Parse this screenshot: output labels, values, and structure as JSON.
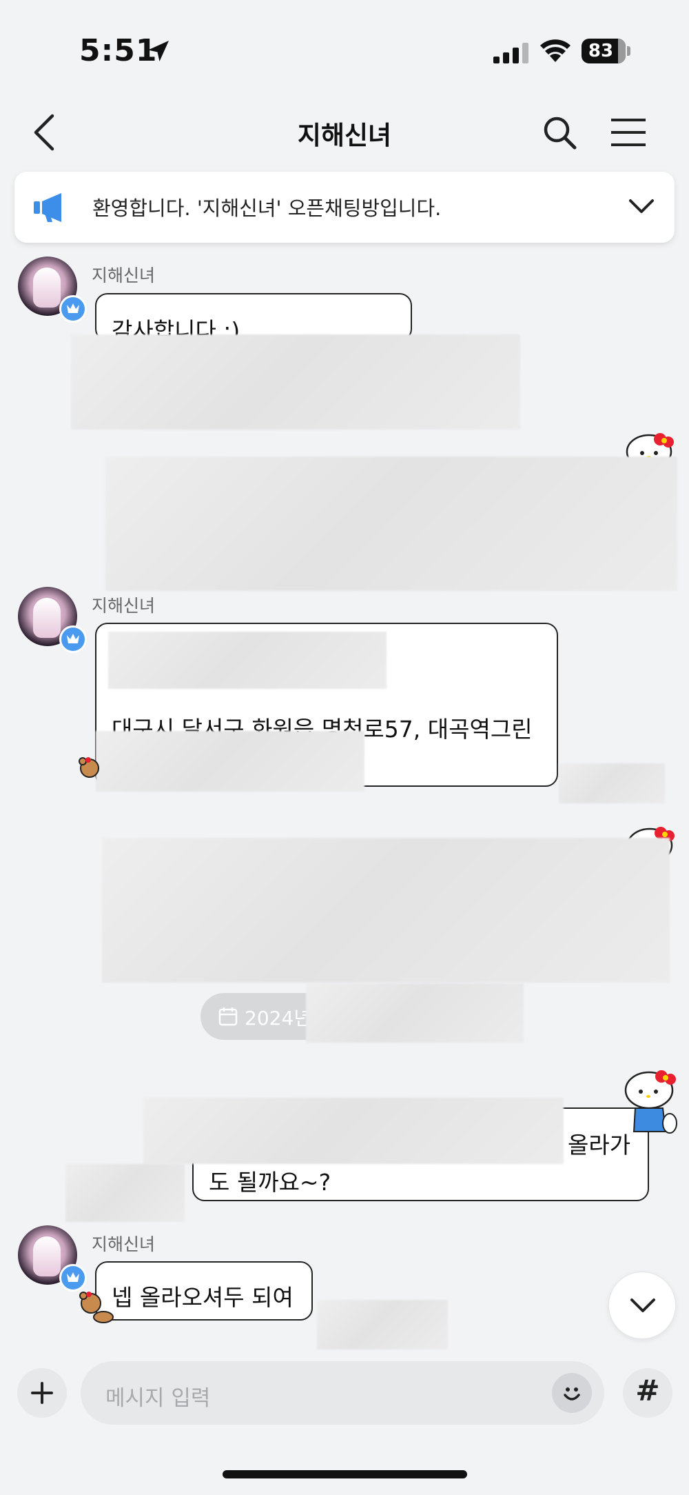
{
  "status_bar": {
    "time": "5:51",
    "battery": "83"
  },
  "header": {
    "title": "지해신녀"
  },
  "notice": {
    "text": "환영합니다. '지해신녀' 오픈채팅방입니다."
  },
  "messages": [
    {
      "sender": "지해신녀",
      "text": "감사합니다 ;)"
    },
    {
      "sender": "지해신녀",
      "text": "대구시 달서구 화원읍 명천로57, 대곡역그린"
    },
    {
      "date": "2024년"
    },
    {
      "mine": true,
      "text_line1": "올라가",
      "text_line2": "도 될까요~?"
    },
    {
      "sender": "지해신녀",
      "text": "넵 올라오셔두 되여"
    }
  ],
  "input": {
    "placeholder": "메시지 입력"
  },
  "colors": {
    "background": "#f2f3f5",
    "accent": "#4a9bef",
    "bubble_border": "#222222"
  }
}
